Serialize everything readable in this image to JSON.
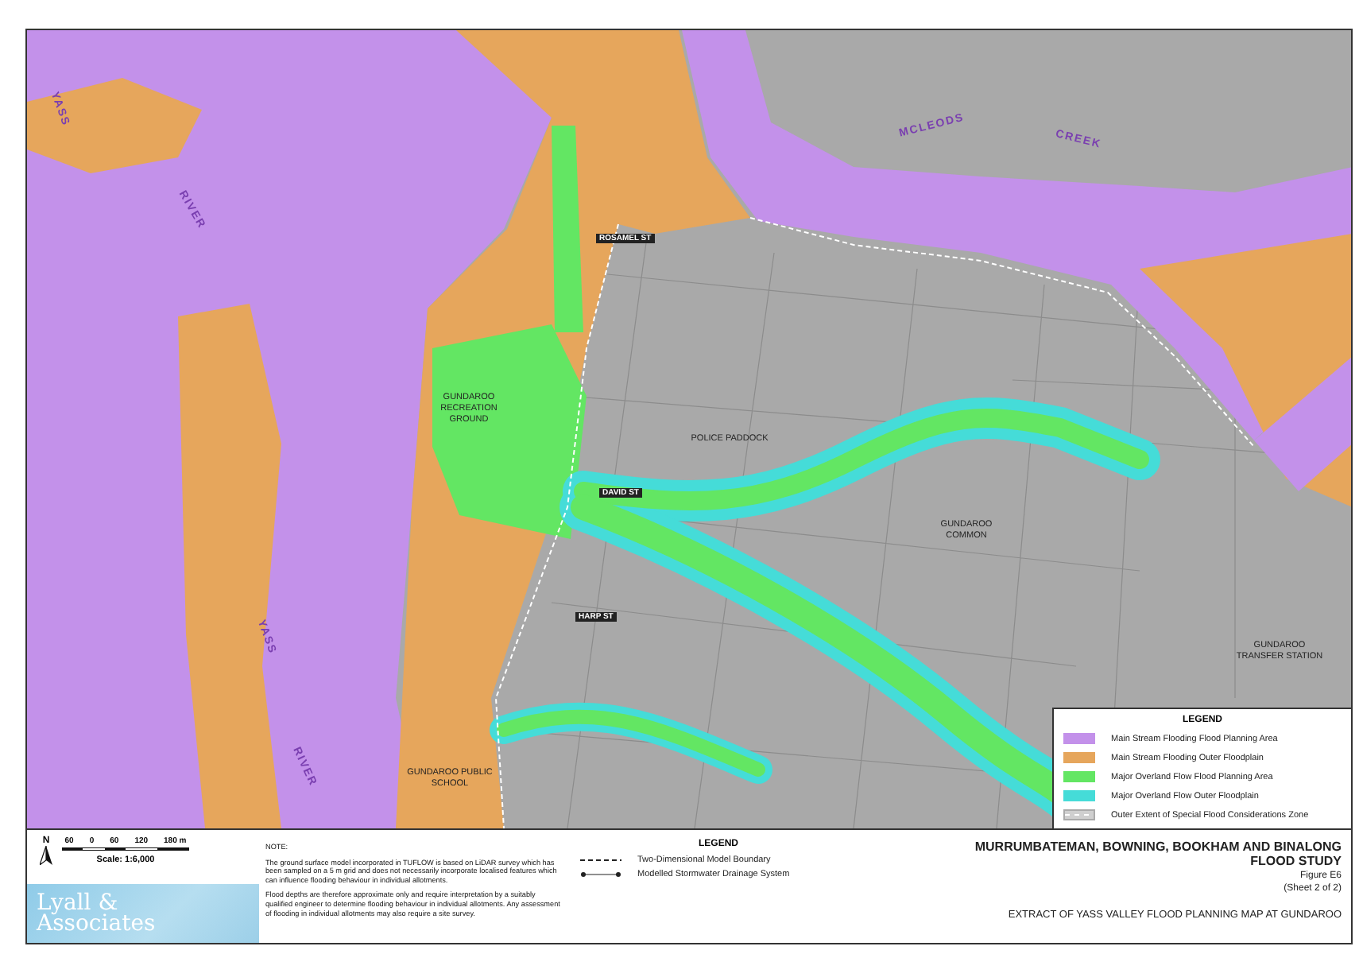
{
  "map": {
    "labels": [
      {
        "text": "MCLEODS",
        "kind": "river"
      },
      {
        "text": "CREEK",
        "kind": "river"
      },
      {
        "text": "YASS",
        "kind": "river"
      },
      {
        "text": "RIVER",
        "kind": "river"
      },
      {
        "text": "YASS",
        "kind": "river"
      },
      {
        "text": "RIVER",
        "kind": "river"
      },
      {
        "text": "GUNDAROO RECREATION GROUND",
        "kind": "place"
      },
      {
        "text": "POLICE PADDOCK",
        "kind": "place"
      },
      {
        "text": "GUNDAROO COMMON",
        "kind": "place"
      },
      {
        "text": "GUNDAROO PUBLIC SCHOOL",
        "kind": "place"
      },
      {
        "text": "GUNDAROO TRANSFER STATION",
        "kind": "place"
      },
      {
        "text": "ROSAMEL ST",
        "kind": "street"
      },
      {
        "text": "DAVID ST",
        "kind": "street"
      },
      {
        "text": "HARP ST",
        "kind": "street"
      }
    ],
    "legend": {
      "title": "LEGEND",
      "items": [
        {
          "label": "Main Stream Flooding Flood Planning Area",
          "color": "#c391ea",
          "kind": "fill"
        },
        {
          "label": "Main Stream Flooding Outer Floodplain",
          "color": "#e6a65c",
          "kind": "fill"
        },
        {
          "label": "Major Overland Flow Flood Planning Area",
          "color": "#63e663",
          "kind": "fill"
        },
        {
          "label": "Major Overland Flow Outer Floodplain",
          "color": "#45dcd8",
          "kind": "fill"
        },
        {
          "label": "Outer Extent of Special Flood Considerations Zone",
          "color": "#cfcfcf",
          "kind": "dashed"
        }
      ]
    }
  },
  "footer": {
    "north": "N",
    "scale": {
      "ticks": [
        "60",
        "0",
        "60",
        "120",
        "180 m"
      ],
      "caption": "Scale: 1:6,000"
    },
    "logo": [
      "Lyall &",
      "Associates"
    ],
    "note": {
      "heading": "NOTE:",
      "paragraphs": [
        "The ground surface model incorporated in TUFLOW is based on LiDAR survey which has been sampled on a 5 m grid and does not necessarily incorporate localised features which can influence flooding behaviour in individual allotments.",
        "Flood depths are therefore approximate only and require interpretation by a suitably qualified engineer to determine flooding behaviour in individual allotments. Any assessment of flooding in individual allotments may also require a site survey."
      ]
    },
    "legend": {
      "title": "LEGEND",
      "items": [
        {
          "label": "Two-Dimensional Model Boundary",
          "kind": "dashed-line"
        },
        {
          "label": "Modelled Stormwater Drainage System",
          "kind": "pipe"
        }
      ]
    },
    "title": [
      "MURRUMBATEMAN, BOWNING, BOOKHAM AND BINALONG",
      "FLOOD STUDY"
    ],
    "figure": "Figure E6",
    "sheet": "(Sheet 2 of 2)",
    "subtitle": "EXTRACT OF YASS VALLEY FLOOD PLANNING MAP AT GUNDAROO"
  }
}
